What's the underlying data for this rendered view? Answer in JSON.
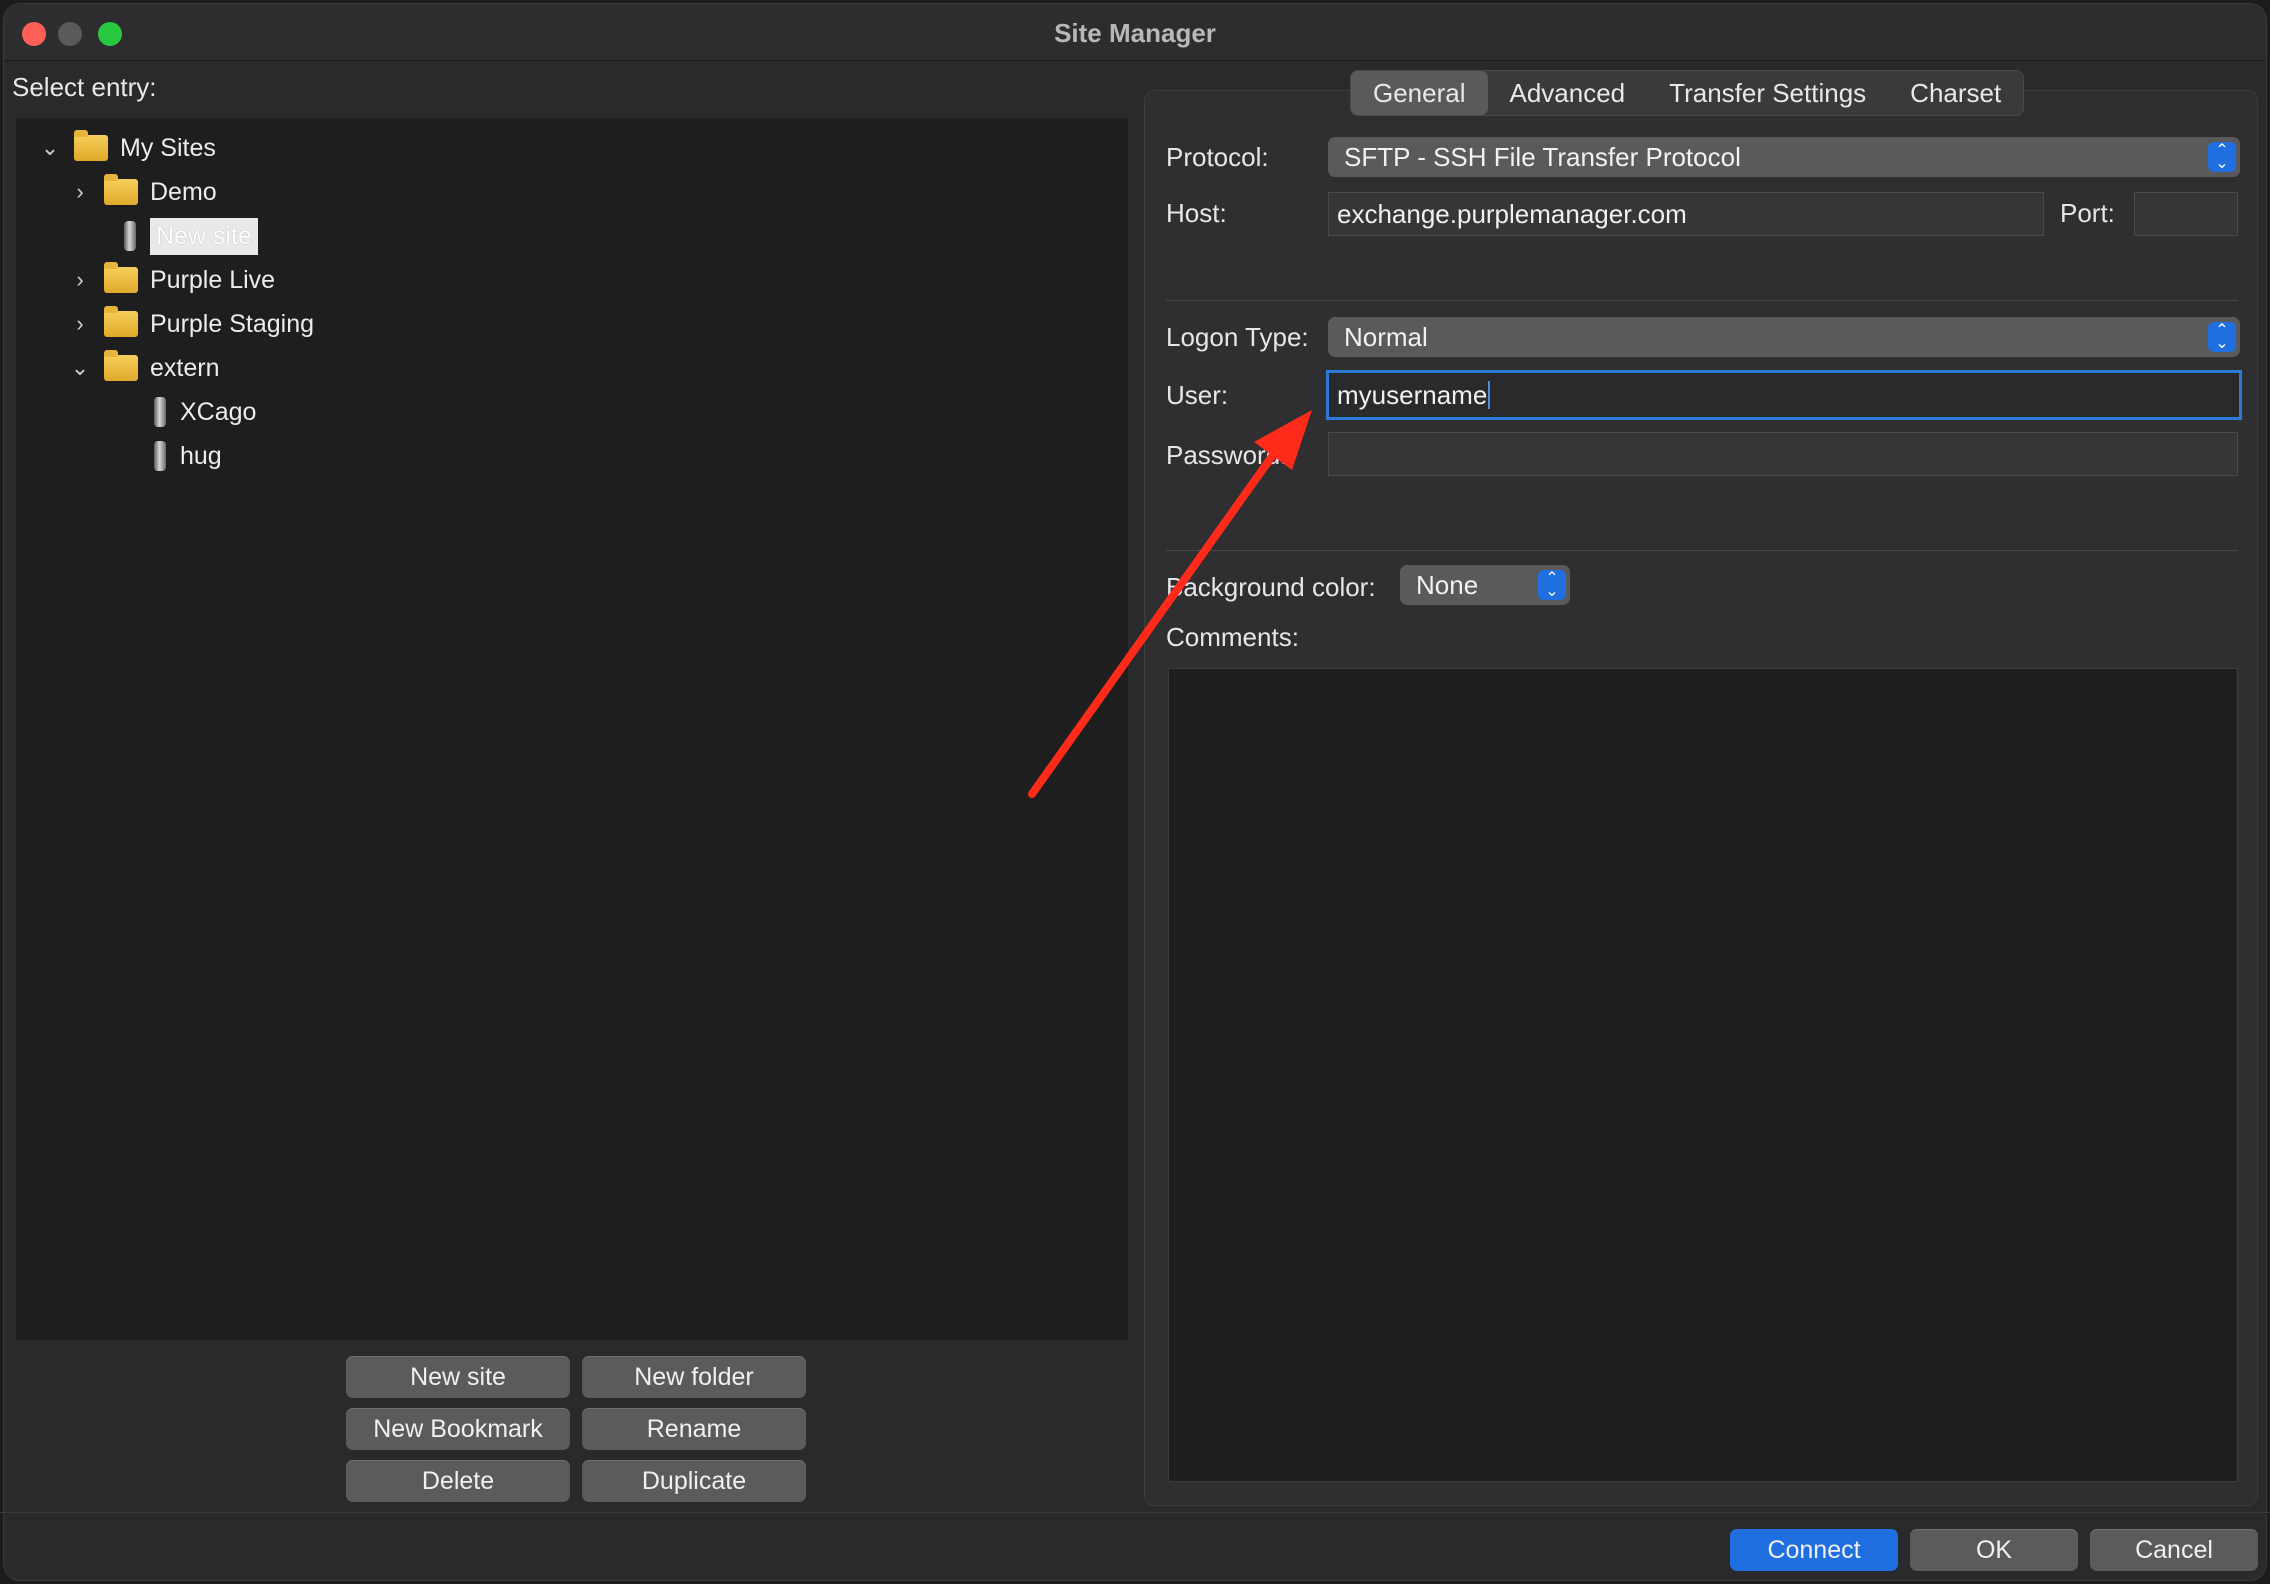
{
  "window": {
    "title": "Site Manager"
  },
  "left": {
    "select_label": "Select entry:",
    "tree": {
      "my_sites": "My Sites",
      "demo": "Demo",
      "new_site": "New site",
      "purple_live": "Purple Live",
      "purple_staging": "Purple Staging",
      "extern": "extern",
      "xcago": "XCago",
      "hug": "hug"
    },
    "buttons": {
      "new_site": "New site",
      "new_folder": "New folder",
      "new_bookmark": "New Bookmark",
      "rename": "Rename",
      "delete": "Delete",
      "duplicate": "Duplicate"
    }
  },
  "tabs": [
    "General",
    "Advanced",
    "Transfer Settings",
    "Charset"
  ],
  "general": {
    "protocol_label": "Protocol:",
    "protocol_value": "SFTP - SSH File Transfer Protocol",
    "host_label": "Host:",
    "host_value": "exchange.purplemanager.com",
    "port_label": "Port:",
    "port_value": "",
    "logon_type_label": "Logon Type:",
    "logon_type_value": "Normal",
    "user_label": "User:",
    "user_value": "myusername",
    "password_label": "Password:",
    "password_value": "",
    "background_color_label": "Background color:",
    "background_color_value": "None",
    "comments_label": "Comments:"
  },
  "footer": {
    "connect": "Connect",
    "ok": "OK",
    "cancel": "Cancel"
  },
  "colors": {
    "accent": "#1f6fe0",
    "annotation_arrow": "#ff2a1a"
  }
}
